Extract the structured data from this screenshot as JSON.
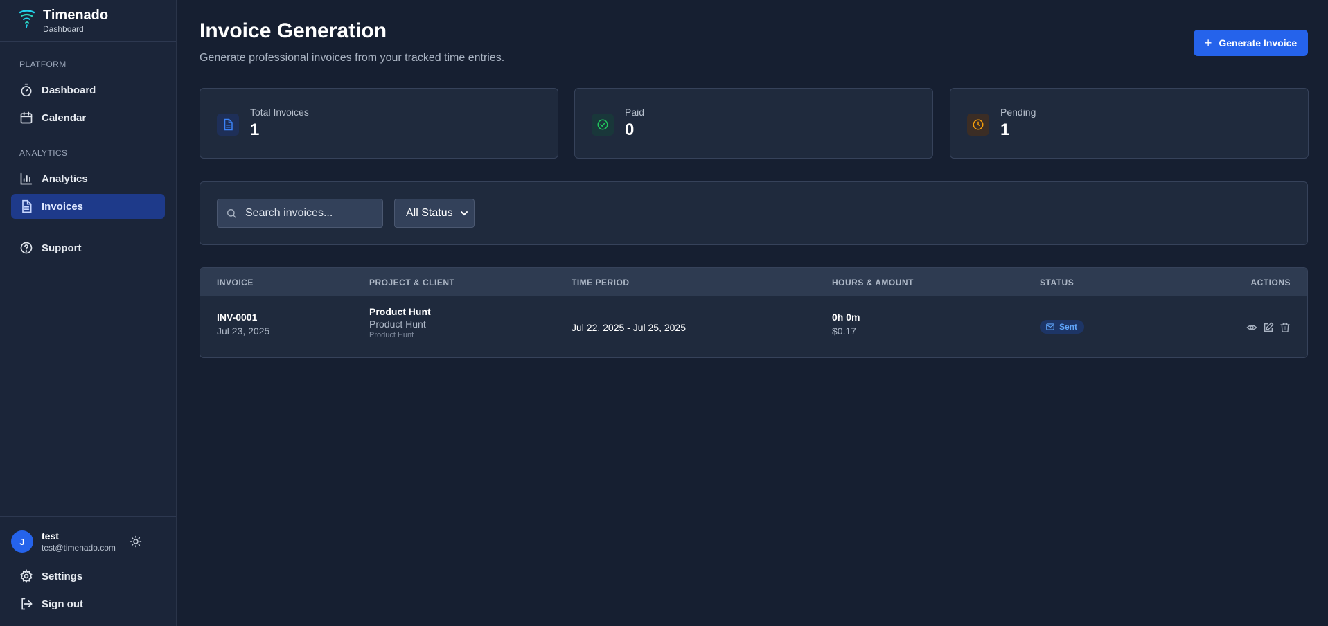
{
  "brand": {
    "name": "Timenado",
    "subtitle": "Dashboard"
  },
  "sidebar": {
    "sections": [
      {
        "label": "PLATFORM"
      },
      {
        "label": "ANALYTICS"
      }
    ],
    "items": [
      {
        "label": "Dashboard",
        "icon": "timer-icon"
      },
      {
        "label": "Calendar",
        "icon": "calendar-icon"
      },
      {
        "label": "Analytics",
        "icon": "bar-chart-icon"
      },
      {
        "label": "Invoices",
        "icon": "file-text-icon",
        "active": true
      },
      {
        "label": "Support",
        "icon": "help-circle-icon"
      }
    ],
    "user": {
      "initial": "J",
      "name": "test",
      "email": "test@timenado.com"
    },
    "bottom": [
      {
        "label": "Settings",
        "icon": "gear-icon"
      },
      {
        "label": "Sign out",
        "icon": "sign-out-icon"
      }
    ]
  },
  "header": {
    "title": "Invoice Generation",
    "subtitle": "Generate professional invoices from your tracked time entries.",
    "generate_label": "Generate Invoice"
  },
  "stats": [
    {
      "label": "Total Invoices",
      "value": "1",
      "color": "#3b82f6"
    },
    {
      "label": "Paid",
      "value": "0",
      "color": "#22c55e"
    },
    {
      "label": "Pending",
      "value": "1",
      "color": "#f59e0b"
    }
  ],
  "filters": {
    "search_placeholder": "Search invoices...",
    "status_selected": "All Status"
  },
  "table": {
    "headers": [
      "INVOICE",
      "PROJECT & CLIENT",
      "TIME PERIOD",
      "HOURS & AMOUNT",
      "STATUS",
      "ACTIONS"
    ],
    "rows": [
      {
        "invoice_number": "INV-0001",
        "invoice_date": "Jul 23, 2025",
        "project": "Product Hunt",
        "client": "Product Hunt",
        "client_detail": "Product Hunt",
        "period": "Jul 22, 2025 - Jul 25, 2025",
        "hours": "0h 0m",
        "amount": "$0.17",
        "status": "Sent"
      }
    ]
  },
  "colors": {
    "accent": "#2563eb",
    "sent_badge": "#60a5fa"
  }
}
